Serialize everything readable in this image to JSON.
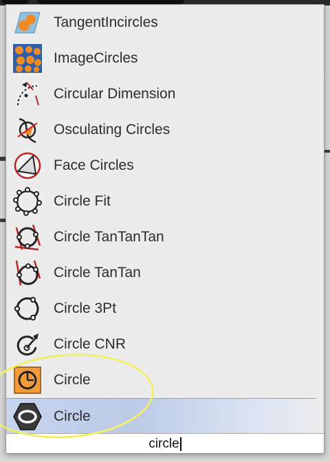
{
  "menu": {
    "items": [
      {
        "label": "TangentIncircles",
        "icon": "tangent-incircles-icon"
      },
      {
        "label": "ImageCircles",
        "icon": "image-circles-icon"
      },
      {
        "label": "Circular Dimension",
        "icon": "circular-dimension-icon"
      },
      {
        "label": "Osculating Circles",
        "icon": "osculating-circles-icon"
      },
      {
        "label": "Face Circles",
        "icon": "face-circles-icon"
      },
      {
        "label": "Circle Fit",
        "icon": "circle-fit-icon"
      },
      {
        "label": "Circle TanTanTan",
        "icon": "circle-tantantan-icon"
      },
      {
        "label": "Circle TanTan",
        "icon": "circle-tantan-icon"
      },
      {
        "label": "Circle 3Pt",
        "icon": "circle-3pt-icon"
      },
      {
        "label": "Circle CNR",
        "icon": "circle-cnr-icon"
      },
      {
        "label": "Circle",
        "icon": "circle-param-icon"
      },
      {
        "label": "Circle",
        "icon": "circle-component-icon",
        "selected": true
      }
    ]
  },
  "search": {
    "value": "circle"
  },
  "colors": {
    "highlight": "#f3ee6a",
    "selection": "#c6d4ee"
  }
}
